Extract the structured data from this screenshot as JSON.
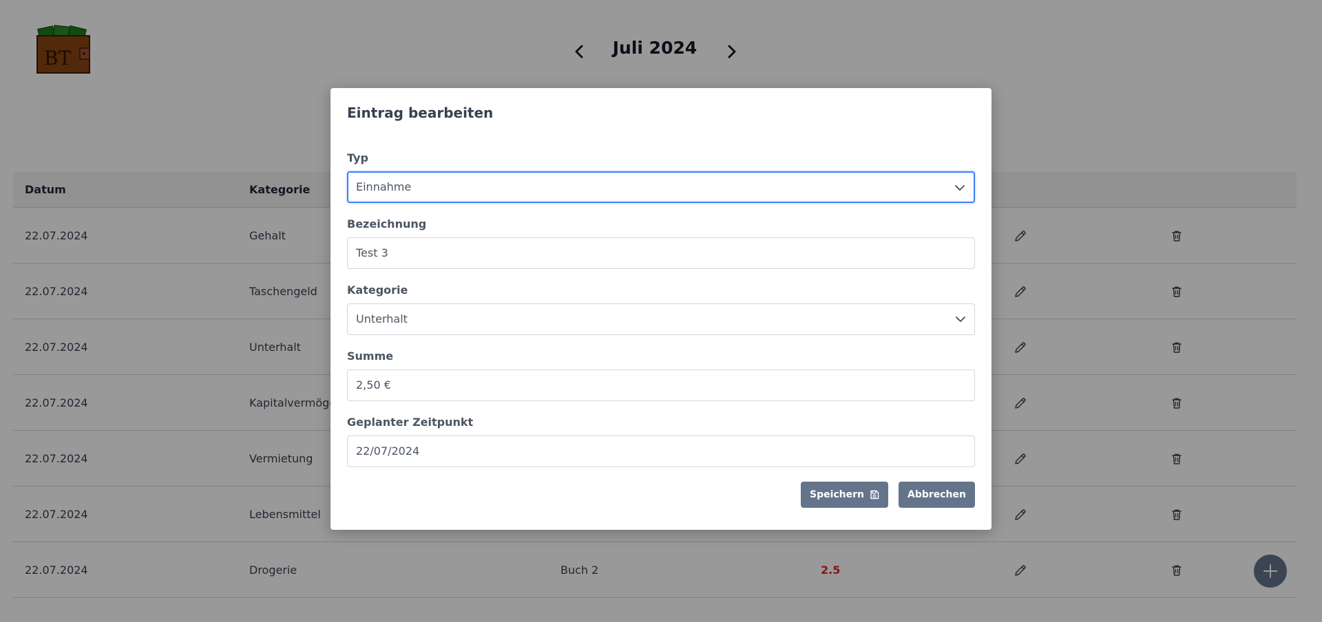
{
  "header": {
    "logo_text": "BT",
    "month_title": "Juli 2024"
  },
  "table": {
    "columns": [
      "Datum",
      "Kategorie"
    ],
    "rows": [
      {
        "date": "22.07.2024",
        "category": "Gehalt",
        "name": "",
        "amount": ""
      },
      {
        "date": "22.07.2024",
        "category": "Taschengeld",
        "name": "",
        "amount": ""
      },
      {
        "date": "22.07.2024",
        "category": "Unterhalt",
        "name": "",
        "amount": ""
      },
      {
        "date": "22.07.2024",
        "category": "Kapitalvermöge",
        "name": "",
        "amount": ""
      },
      {
        "date": "22.07.2024",
        "category": "Vermietung",
        "name": "",
        "amount": ""
      },
      {
        "date": "22.07.2024",
        "category": "Lebensmittel",
        "name": "",
        "amount": ""
      },
      {
        "date": "22.07.2024",
        "category": "Drogerie",
        "name": "Buch 2",
        "amount": "2.5"
      }
    ]
  },
  "modal": {
    "title": "Eintrag bearbeiten",
    "type": {
      "label": "Typ",
      "value": "Einnahme"
    },
    "designation": {
      "label": "Bezeichnung",
      "value": "Test 3"
    },
    "category": {
      "label": "Kategorie",
      "value": "Unterhalt"
    },
    "sum": {
      "label": "Summe",
      "value": "2,50 €"
    },
    "planned_time": {
      "label": "Geplanter Zeitpunkt",
      "value": "22/07/2024"
    },
    "save_label": "Speichern",
    "cancel_label": "Abbrechen"
  },
  "icons": {
    "prev": "chevron-left-icon",
    "next": "chevron-right-icon",
    "edit": "pencil-icon",
    "delete": "trash-icon",
    "add": "plus-icon",
    "save": "floppy-disk-icon",
    "dropdown": "chevron-down-icon"
  },
  "colors": {
    "accent_button": "#64748b",
    "amount_negative": "#dc2626",
    "focus_ring": "#3b82f6",
    "logo_wood": "#8b4513",
    "logo_money": "#1f7a1f"
  }
}
